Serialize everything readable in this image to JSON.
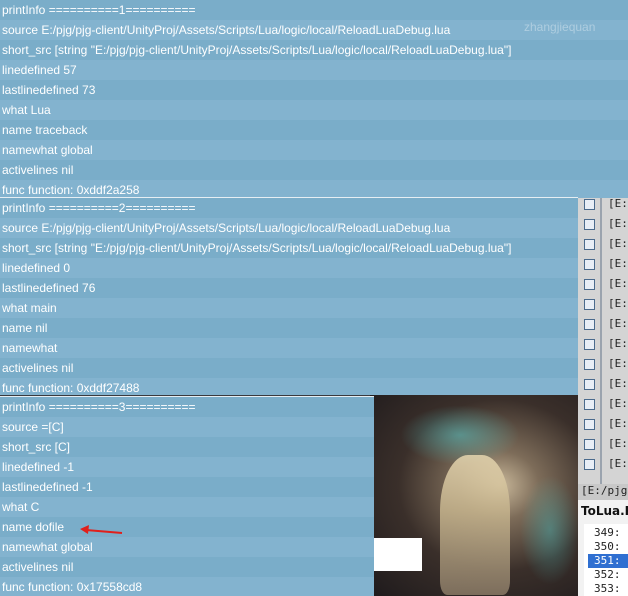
{
  "watermark": "zhangjiequan",
  "panel1": {
    "rows": [
      "printInfo ==========1==========",
      "source E:/pjg/pjg-client/UnityProj/Assets/Scripts/Lua/logic/local/ReloadLuaDebug.lua",
      "short_src [string \"E:/pjg/pjg-client/UnityProj/Assets/Scripts/Lua/logic/local/ReloadLuaDebug.lua\"]",
      "linedefined 57",
      "lastlinedefined 73",
      "what Lua",
      "name traceback",
      "namewhat global",
      "activelines nil",
      "func function: 0xddf2a258"
    ]
  },
  "panel2": {
    "rows": [
      "printInfo ==========2==========",
      "source E:/pjg/pjg-client/UnityProj/Assets/Scripts/Lua/logic/local/ReloadLuaDebug.lua",
      "short_src [string \"E:/pjg/pjg-client/UnityProj/Assets/Scripts/Lua/logic/local/ReloadLuaDebug.lua\"]",
      "linedefined 0",
      "lastlinedefined 76",
      "what main",
      "name nil",
      "namewhat",
      "activelines nil",
      "func function: 0xddf27488"
    ]
  },
  "panel3": {
    "rows": [
      "printInfo ==========3==========",
      "source =[C]",
      "short_src [C]",
      "linedefined -1",
      "lastlinedefined -1",
      "what C",
      "name dofile",
      "namewhat global",
      "activelines nil",
      "func function: 0x17558cd8"
    ]
  },
  "right_panel": {
    "row_text": "[E:/",
    "rows": 14
  },
  "path_tab": "[E:/pjg/",
  "line_panel": {
    "title": "ToLua.P",
    "numbers": [
      "349:",
      "350:",
      "351:",
      "352:",
      "353:"
    ],
    "selected_index": 2
  },
  "colors": {
    "log_bg": "#7fb0cc",
    "log_text": "#ffffff",
    "arrow": "#e0201c",
    "selection": "#2f6fd1"
  }
}
